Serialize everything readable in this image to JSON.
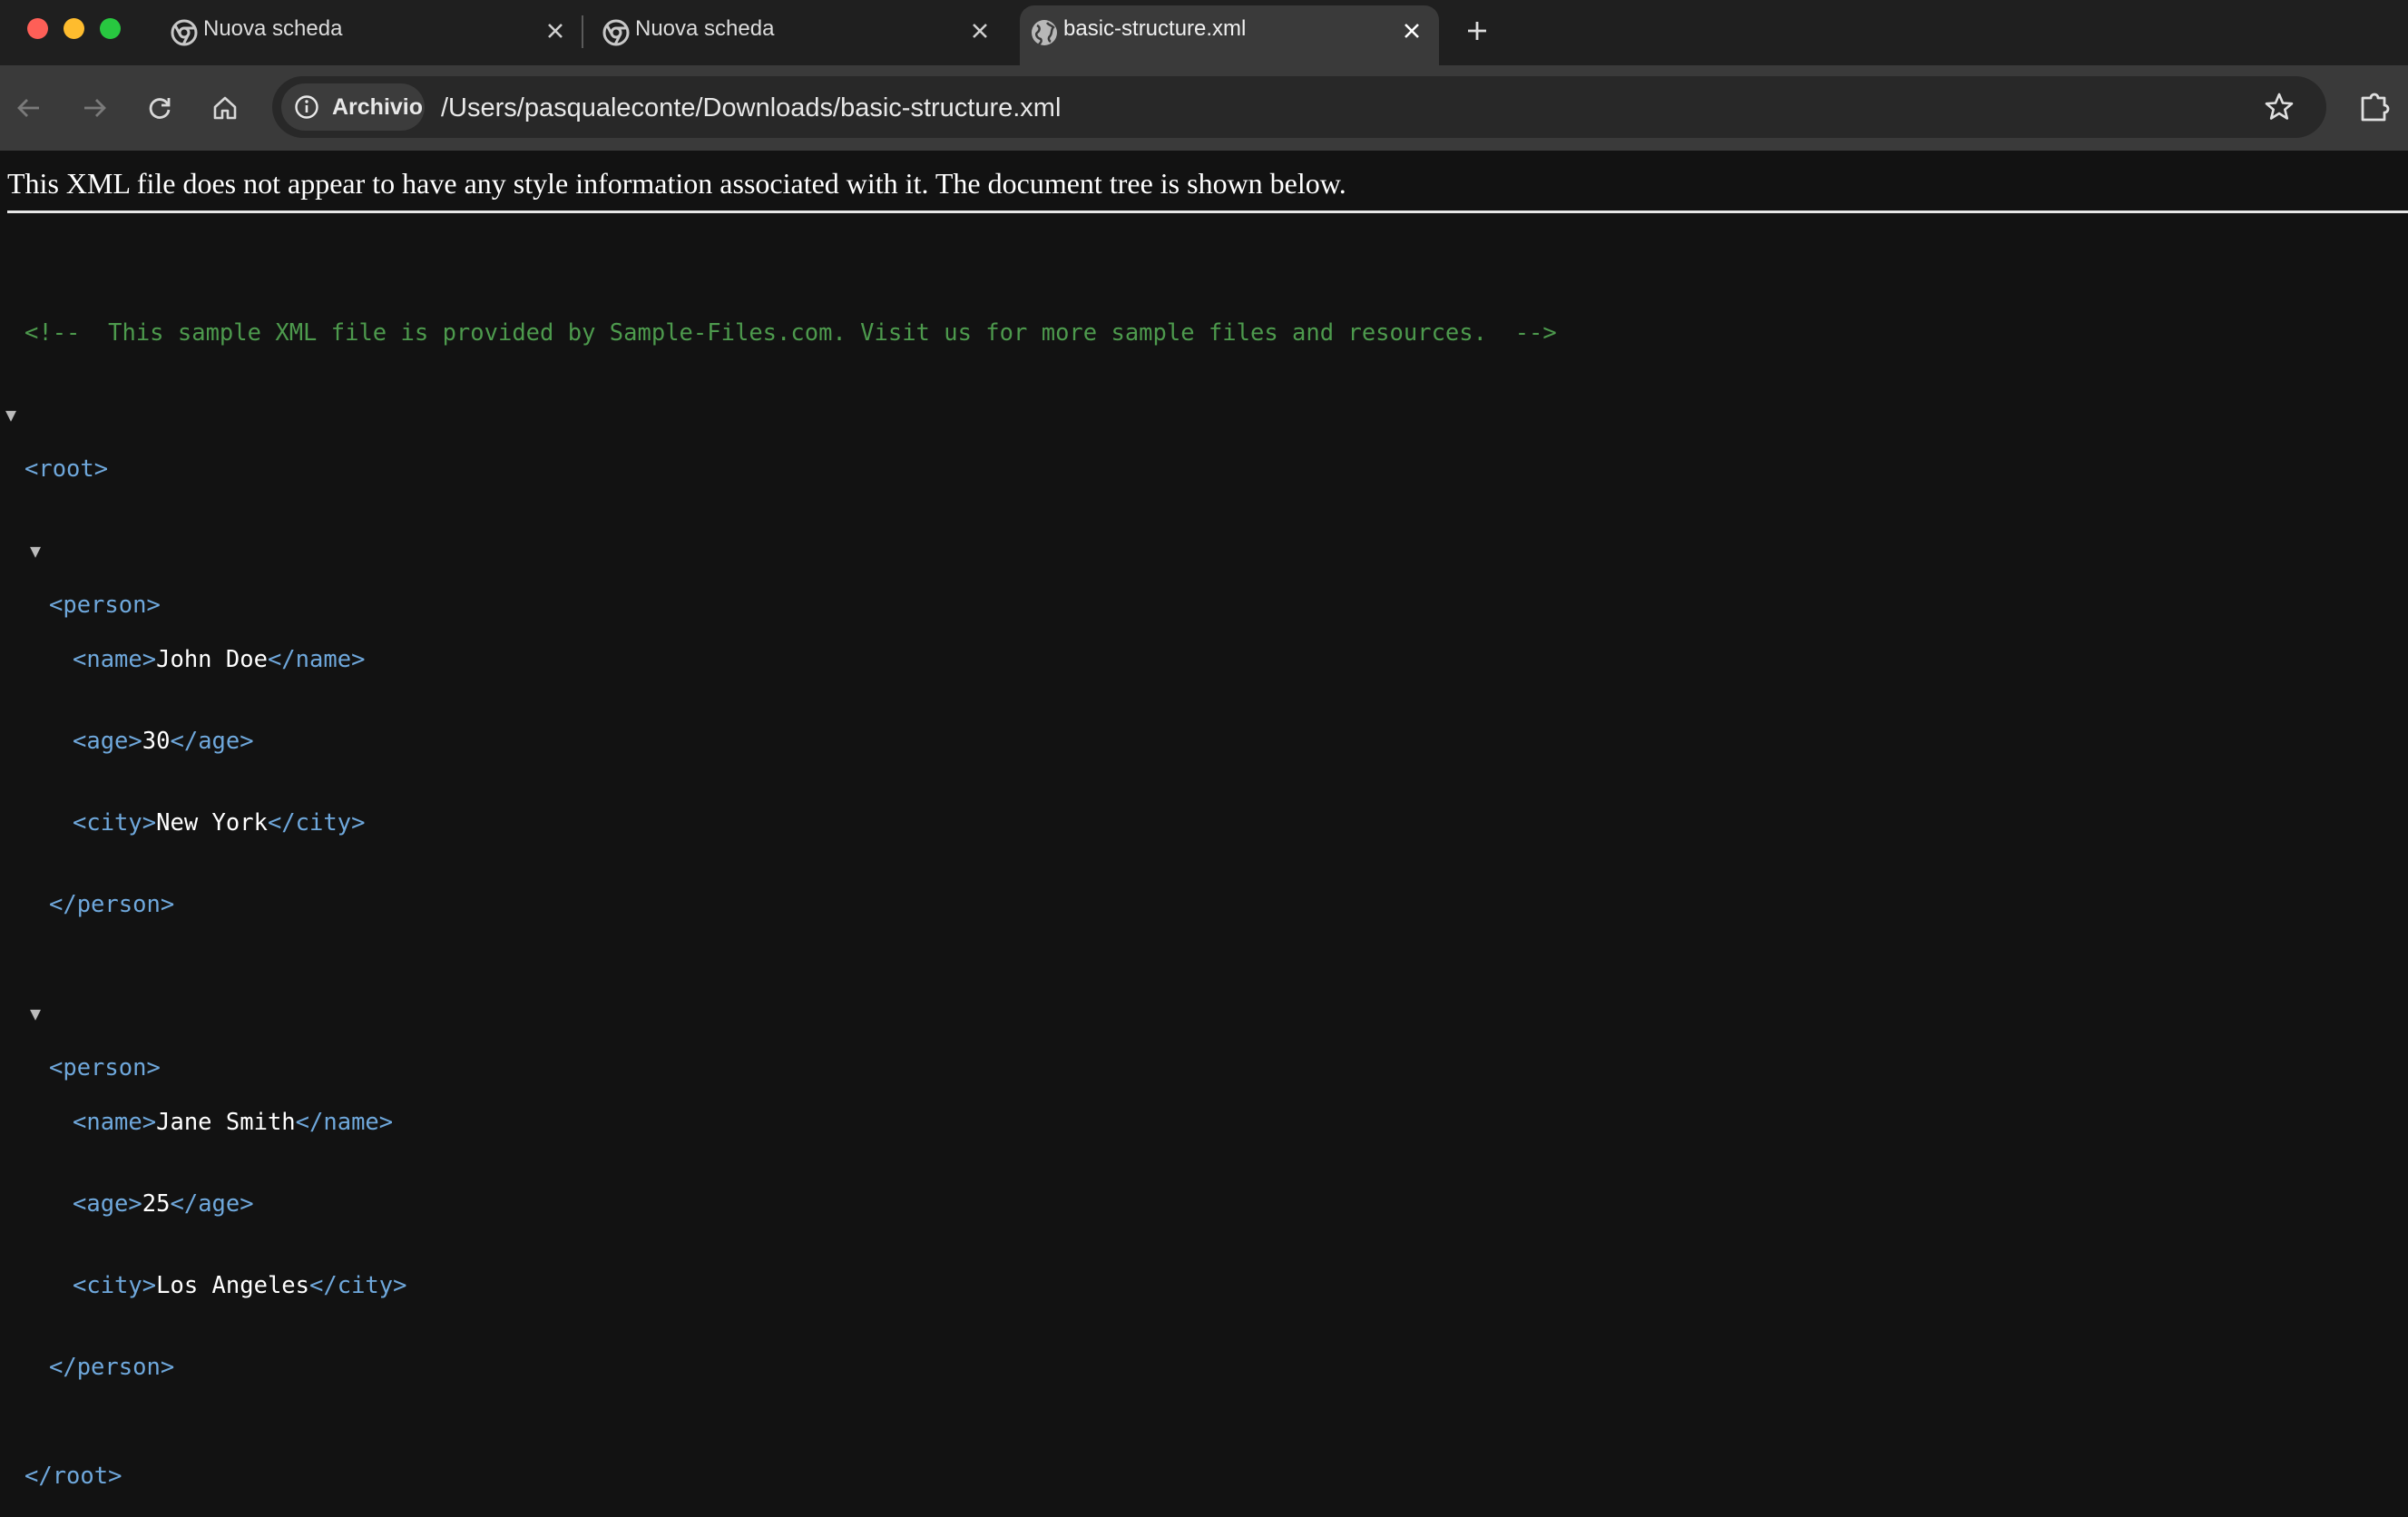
{
  "window": {
    "traffic_lights": [
      "close",
      "minimize",
      "zoom"
    ]
  },
  "tabs": [
    {
      "title": "Nuova scheda",
      "icon": "chrome-icon",
      "active": false
    },
    {
      "title": "Nuova scheda",
      "icon": "chrome-icon",
      "active": false
    },
    {
      "title": "basic-structure.xml",
      "icon": "globe-icon",
      "active": true
    }
  ],
  "toolbar": {
    "security_chip": "Archivio",
    "url": "/Users/pasqualeconte/Downloads/basic-structure.xml"
  },
  "page": {
    "info_message": "This XML file does not appear to have any style information associated with it. The document tree is shown below.",
    "comment": "<!--  This sample XML file is provided by Sample-Files.com. Visit us for more sample files and resources.  -->",
    "root_open": "<root>",
    "root_close": "</root>",
    "persons": [
      {
        "open": "<person>",
        "close": "</person>",
        "fields": [
          {
            "open": "<name>",
            "value": "John Doe",
            "close": "</name>"
          },
          {
            "open": "<age>",
            "value": "30",
            "close": "</age>"
          },
          {
            "open": "<city>",
            "value": "New York",
            "close": "</city>"
          }
        ]
      },
      {
        "open": "<person>",
        "close": "</person>",
        "fields": [
          {
            "open": "<name>",
            "value": "Jane Smith",
            "close": "</name>"
          },
          {
            "open": "<age>",
            "value": "25",
            "close": "</age>"
          },
          {
            "open": "<city>",
            "value": "Los Angeles",
            "close": "</city>"
          }
        ]
      }
    ]
  },
  "colors": {
    "comment": "#4d9a4d",
    "tag": "#6fa8dc",
    "text": "#ffffff",
    "background": "#121212"
  }
}
